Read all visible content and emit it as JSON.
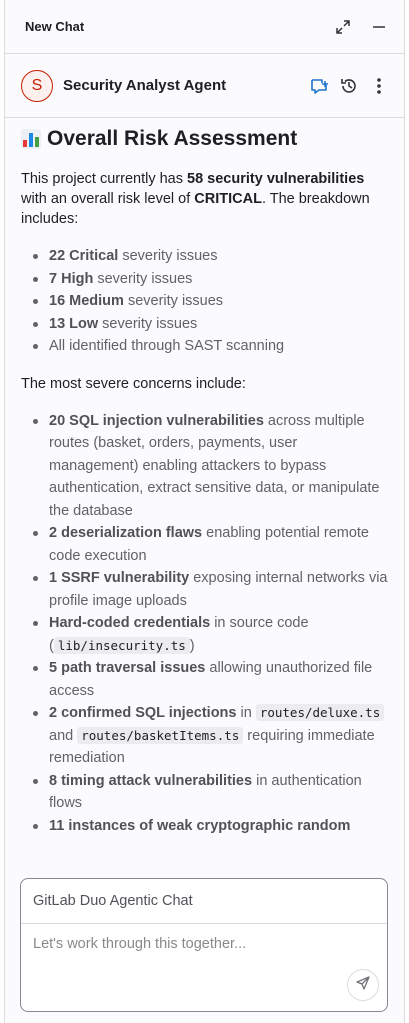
{
  "window": {
    "title": "New Chat"
  },
  "agent": {
    "initial": "S",
    "name": "Security Analyst Agent"
  },
  "content": {
    "heading": "Overall Risk Assessment",
    "intro": {
      "pre": "This project currently has ",
      "bold1": "58 security vulnerabilities",
      "mid": " with an overall risk level of ",
      "bold2": "CRITICAL",
      "post": ". The breakdown includes:"
    },
    "breakdown": [
      {
        "bold": "22 Critical",
        "text": " severity issues"
      },
      {
        "bold": "7 High",
        "text": " severity issues"
      },
      {
        "bold": "16 Medium",
        "text": " severity issues"
      },
      {
        "bold": "13 Low",
        "text": " severity issues"
      },
      {
        "bold": "",
        "text": "All identified through SAST scanning"
      }
    ],
    "concerns_intro": "The most severe concerns include:",
    "concerns": {
      "c1": {
        "bold": "20 SQL injection vulnerabilities",
        "text": " across multiple routes (basket, orders, payments, user management) enabling attackers to bypass authentication, extract sensitive data, or manipulate the database"
      },
      "c2": {
        "bold": "2 deserialization flaws",
        "text": " enabling potential remote code execution"
      },
      "c3": {
        "bold": "1 SSRF vulnerability",
        "text": " exposing internal networks via profile image uploads"
      },
      "c4": {
        "bold": "Hard-coded credentials",
        "pre": " in source code (",
        "code": "lib/insecurity.ts",
        "post": ")"
      },
      "c5": {
        "bold": "5 path traversal issues",
        "text": " allowing unauthorized file access"
      },
      "c6": {
        "bold": "2 confirmed SQL injections",
        "pre": " in ",
        "code1": "routes/deluxe.ts",
        "mid": " and ",
        "code2": "routes/basketItems.ts",
        "post": " requiring immediate remediation"
      },
      "c7": {
        "bold": "8 timing attack vulnerabilities",
        "text": " in authentication flows"
      },
      "c8": {
        "bold": "11 instances of weak cryptographic random",
        "text": ""
      }
    }
  },
  "composer": {
    "label": "GitLab Duo Agentic Chat",
    "placeholder": "Let's work through this together..."
  },
  "icons": {
    "maximize": "maximize-icon",
    "minimize": "minimize-icon",
    "new_chat": "new-chat-icon",
    "history": "history-icon",
    "more": "kebab-menu-icon",
    "send": "send-icon",
    "chart": "bar-chart-emoji"
  },
  "colors": {
    "accent": "#1f75cb",
    "avatar_border": "#c91c00",
    "text": "#1f1e24"
  }
}
